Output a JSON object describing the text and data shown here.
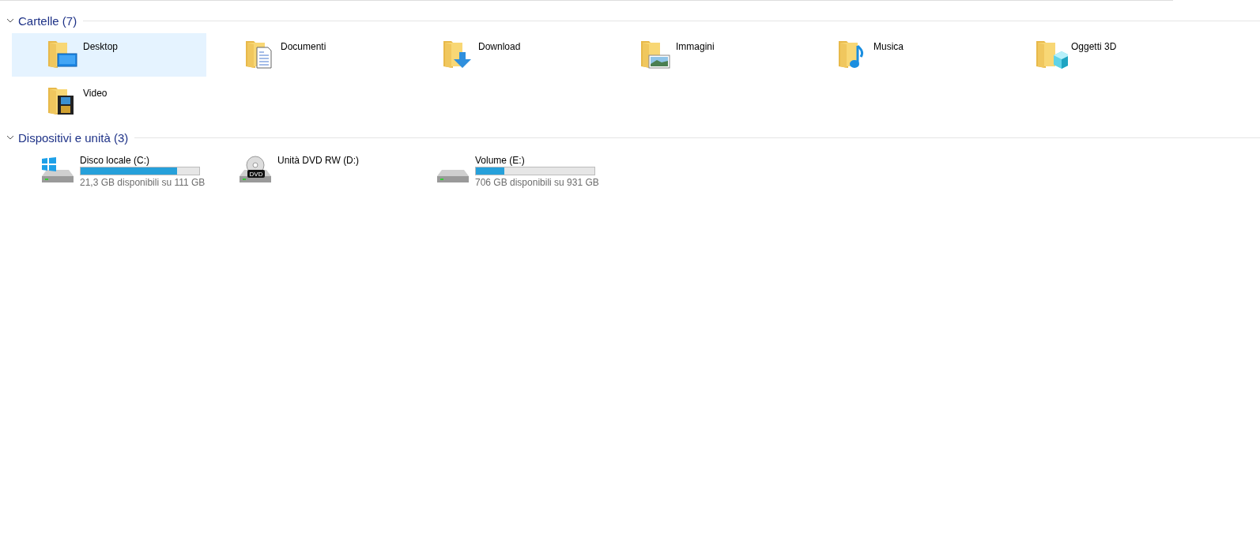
{
  "groups": [
    {
      "title": "Cartelle (7)",
      "expanded": true,
      "kind": "folders",
      "items": [
        {
          "name": "Desktop",
          "kind": "desktop",
          "selected": true
        },
        {
          "name": "Documenti",
          "kind": "documents",
          "selected": false
        },
        {
          "name": "Download",
          "kind": "download",
          "selected": false
        },
        {
          "name": "Immagini",
          "kind": "pictures",
          "selected": false
        },
        {
          "name": "Musica",
          "kind": "music",
          "selected": false
        },
        {
          "name": "Oggetti 3D",
          "kind": "objects3d",
          "selected": false
        },
        {
          "name": "Video",
          "kind": "video",
          "selected": false
        }
      ]
    },
    {
      "title": "Dispositivi e unità (3)",
      "expanded": true,
      "kind": "drives",
      "items": [
        {
          "name": "Disco locale (C:)",
          "kind": "windows",
          "selected": false,
          "level": 0.81,
          "space": "21,3 GB disponibili su 111 GB"
        },
        {
          "name": "Unità DVD RW (D:)",
          "kind": "dvd",
          "selected": false,
          "icon_label": "DVD"
        },
        {
          "name": "Volume (E:)",
          "kind": "hdd",
          "selected": false,
          "level": 0.24,
          "space": "706 GB disponibili su 931 GB"
        }
      ]
    }
  ]
}
